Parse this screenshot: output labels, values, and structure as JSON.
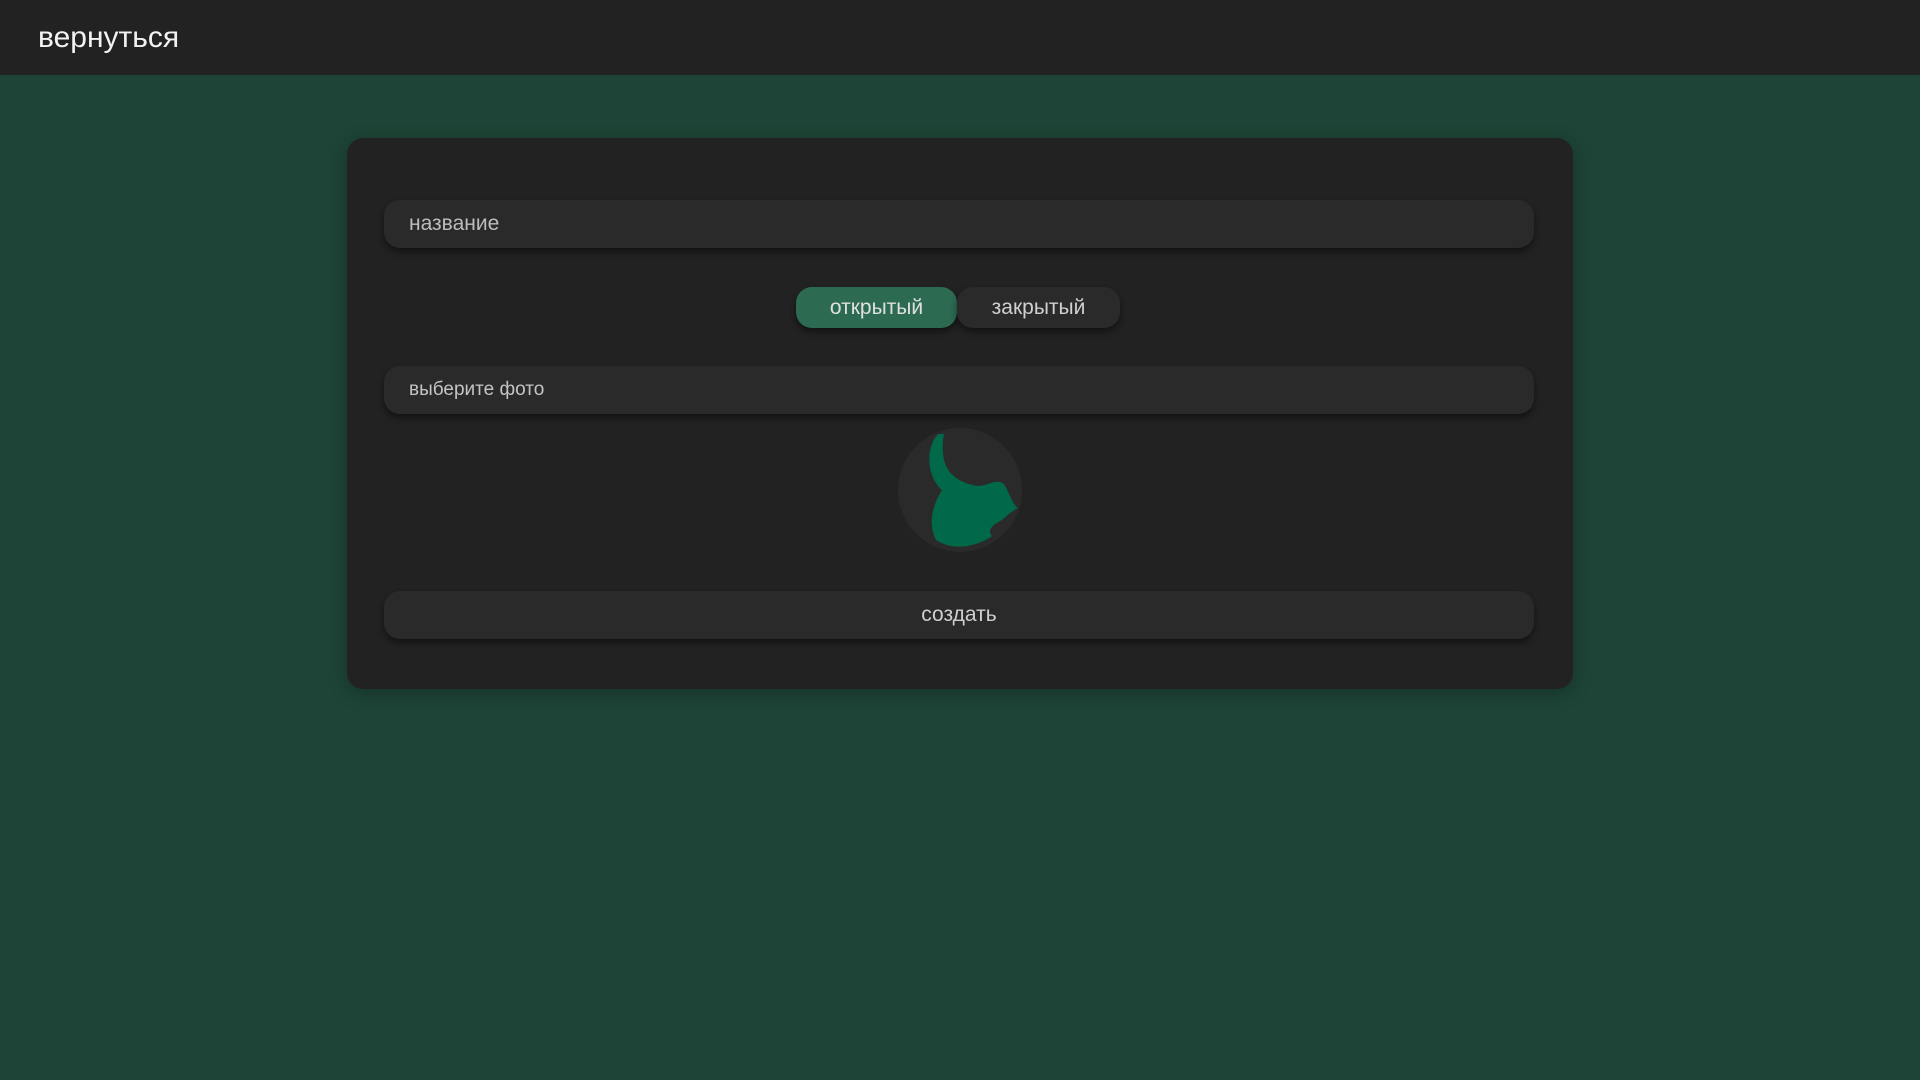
{
  "header": {
    "back_label": "вернуться"
  },
  "form": {
    "name_placeholder": "название",
    "visibility_options": [
      "открытый",
      "закрытый"
    ],
    "visibility_selected": "открытый",
    "photo_label": "выберите фото",
    "submit_label": "создать"
  },
  "colors": {
    "page_background": "#1d4436",
    "panel_background": "#222222",
    "field_background": "#2a2a2a",
    "accent": "#2c6a52",
    "avatar_shape": "#00694a"
  },
  "icons": {
    "avatar": "bird-avatar-icon"
  }
}
